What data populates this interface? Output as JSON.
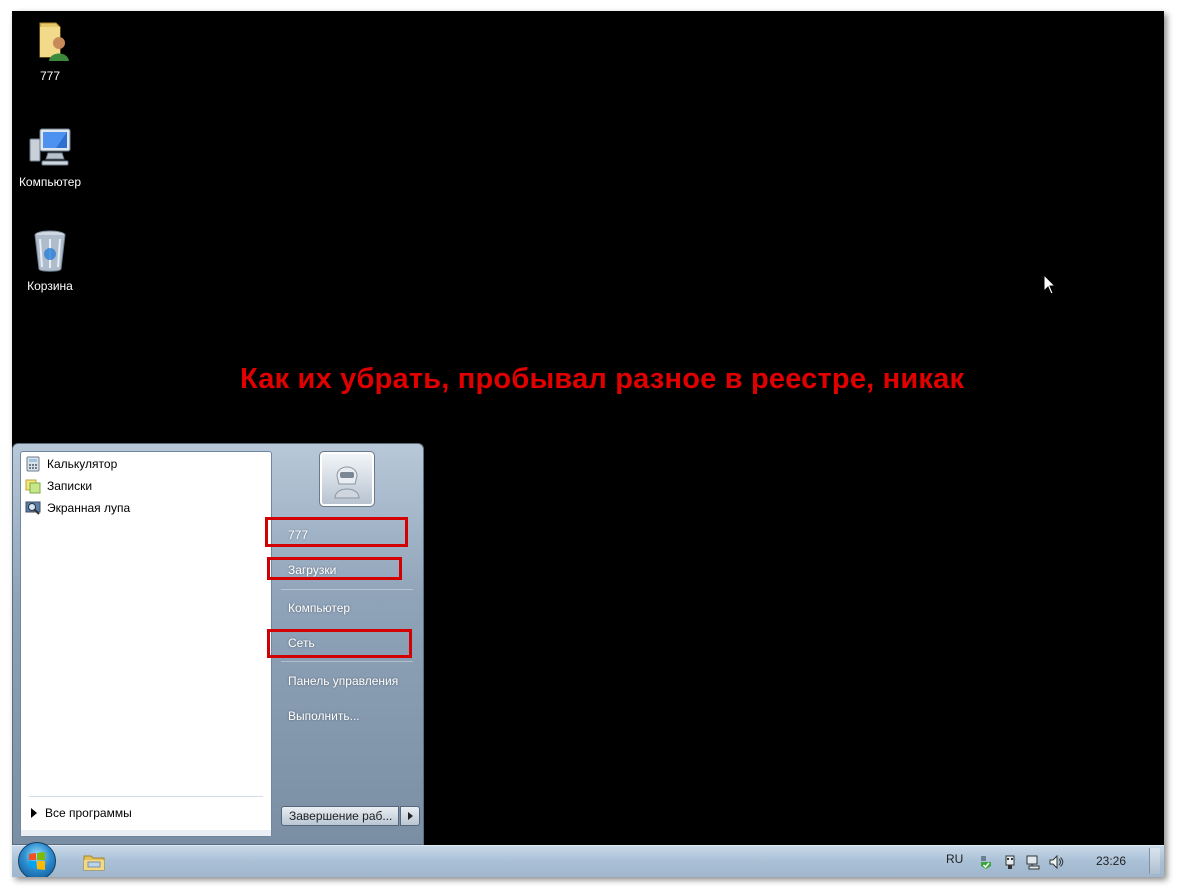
{
  "desktop": {
    "icons": [
      {
        "label": "777",
        "icon": "user-folder-icon"
      },
      {
        "label": "Компьютер",
        "icon": "computer-icon"
      },
      {
        "label": "Корзина",
        "icon": "recycle-bin-icon"
      }
    ],
    "annotation": "Как их убрать, пробывал разное в реестре, никак",
    "annotation_color": "#e00000",
    "background_color": "#000000"
  },
  "start_menu": {
    "programs": [
      {
        "label": "Калькулятор",
        "icon": "calculator-icon"
      },
      {
        "label": "Записки",
        "icon": "sticky-notes-icon"
      },
      {
        "label": "Экранная лупа",
        "icon": "magnifier-icon"
      }
    ],
    "all_programs": "Все программы",
    "right_items": {
      "user": "777",
      "downloads": "Загрузки",
      "computer": "Компьютер",
      "network": "Сеть",
      "control_panel": "Панель управления",
      "run": "Выполнить..."
    },
    "shutdown_label": "Завершение раб...",
    "highlight_color": "#d20000"
  },
  "taskbar": {
    "language": "RU",
    "clock": "23:26",
    "tray_icons": [
      "action-center-icon",
      "network-icon",
      "devices-icon",
      "volume-icon"
    ]
  }
}
